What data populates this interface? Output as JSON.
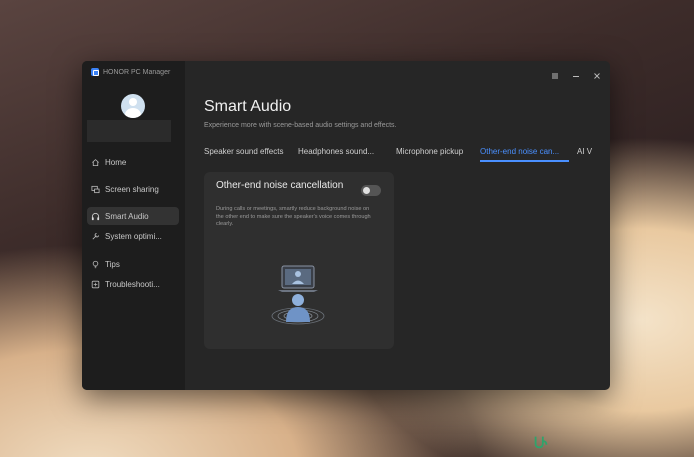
{
  "app": {
    "title": "HONOR PC Manager"
  },
  "window_controls": [
    "menu",
    "minimize",
    "close"
  ],
  "sidebar": {
    "items": [
      {
        "label": "Home",
        "icon": "home-icon",
        "active": false
      },
      {
        "label": "Screen sharing",
        "icon": "screen-share-icon",
        "active": false
      },
      {
        "label": "Smart Audio",
        "icon": "headphones-icon",
        "active": true
      },
      {
        "label": "System optimi...",
        "icon": "wrench-icon",
        "active": false
      },
      {
        "label": "Tips",
        "icon": "lightbulb-icon",
        "active": false
      },
      {
        "label": "Troubleshooti...",
        "icon": "troubleshoot-icon",
        "active": false
      }
    ]
  },
  "main": {
    "title": "Smart Audio",
    "subtitle": "Experience more with scene-based audio settings and effects.",
    "tabs": [
      {
        "label": "Speaker sound effects"
      },
      {
        "label": "Headphones sound..."
      },
      {
        "label": "Microphone pickup"
      },
      {
        "label": "Other-end noise can...",
        "active": true
      },
      {
        "label": "AI V"
      }
    ],
    "card": {
      "title": "Other-end noise cancellation",
      "description": "During calls or meetings, smartly reduce background noise on the other end to make sure the speaker's voice comes through clearly.",
      "toggle_on": false
    }
  },
  "colors": {
    "accent": "#4a90ff",
    "window_bg": "#262626",
    "sidebar_bg": "#1d1d1d"
  }
}
